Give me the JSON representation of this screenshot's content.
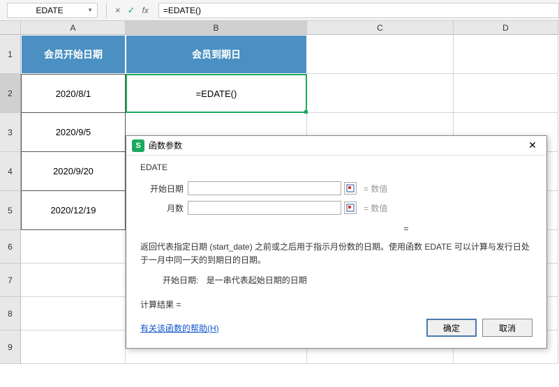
{
  "formula_bar": {
    "name_box": "EDATE",
    "cancel_icon": "×",
    "accept_icon": "✓",
    "fx_label": "fx",
    "formula": "=EDATE()"
  },
  "columns": [
    "A",
    "B",
    "C",
    "D"
  ],
  "rows": [
    "1",
    "2",
    "3",
    "4",
    "5",
    "6",
    "7",
    "8",
    "9"
  ],
  "headers": {
    "A": "会员开始日期",
    "B": "会员到期日"
  },
  "data": {
    "A2": "2020/8/1",
    "A3": "2020/9/5",
    "A4": "2020/9/20",
    "A5": "2020/12/19",
    "B2": "=EDATE()"
  },
  "dialog": {
    "logo": "S",
    "title": "函数参数",
    "close": "✕",
    "fn_name": "EDATE",
    "args": [
      {
        "label": "开始日期",
        "value": "",
        "result": "= 数值"
      },
      {
        "label": "月数",
        "value": "",
        "result": "= 数值"
      }
    ],
    "eq": "=",
    "description": "返回代表指定日期 (start_date) 之前或之后用于指示月份数的日期。使用函数 EDATE 可以计算与发行日处于一月中同一天的到期日的日期。",
    "arg_name": "开始日期:",
    "arg_detail": "是一串代表起始日期的日期",
    "calc_label": "计算结果 =",
    "calc_value": "",
    "help_link": "有关该函数的帮助(H)",
    "ok": "确定",
    "cancel": "取消"
  }
}
